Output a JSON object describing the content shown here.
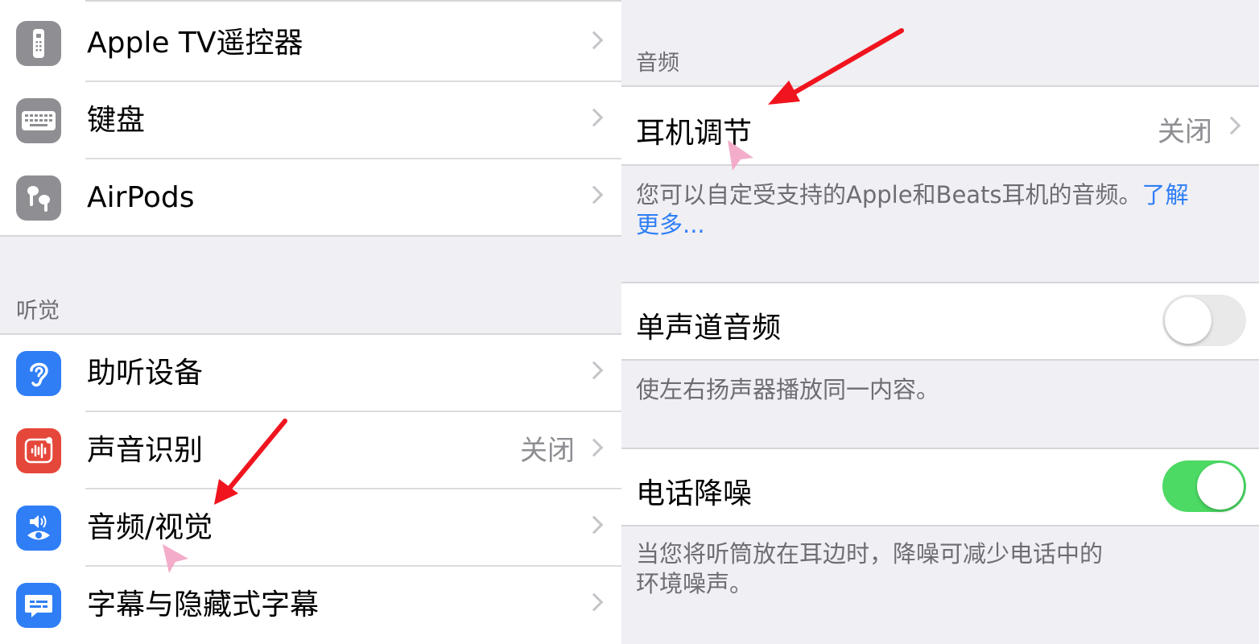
{
  "left": {
    "top_rows": [
      {
        "label": "Apple TV遥控器",
        "icon": "remote-icon"
      },
      {
        "label": "键盘",
        "icon": "keyboard-icon"
      },
      {
        "label": "AirPods",
        "icon": "airpods-icon"
      }
    ],
    "hearing_header": "听觉",
    "hearing_rows": [
      {
        "label": "助听设备",
        "value": "",
        "icon": "ear-icon"
      },
      {
        "label": "声音识别",
        "value": "关闭",
        "icon": "sound-recognition-icon"
      },
      {
        "label": "音频/视觉",
        "value": "",
        "icon": "speaker-eye-icon"
      },
      {
        "label": "字幕与隐藏式字幕",
        "value": "",
        "icon": "subtitles-icon"
      }
    ]
  },
  "right": {
    "audio_header": "音频",
    "headphone": {
      "label": "耳机调节",
      "value": "关闭"
    },
    "headphone_note": "您可以自定受支持的Apple和Beats耳机的音频。",
    "headphone_link_1": "了解",
    "headphone_link_2": "更多...",
    "mono": {
      "label": "单声道音频",
      "on": false
    },
    "mono_note": "使左右扬声器播放同一内容。",
    "noise": {
      "label": "电话降噪",
      "on": true
    },
    "noise_note_1": "当您将听筒放在耳边时，降噪可减少电话中的",
    "noise_note_2": "环境噪声。"
  },
  "colors": {
    "toggle_on": "#4cd964",
    "link": "#2f7ef6",
    "annotation_arrow": "#f0141e"
  }
}
